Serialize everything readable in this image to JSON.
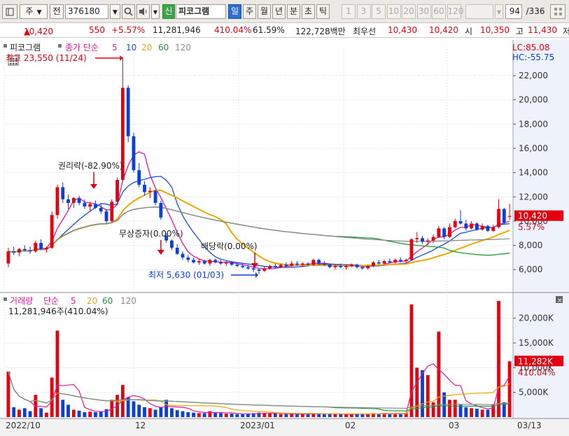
{
  "toolbar": {
    "market_label": "주",
    "chart_label": "전",
    "code": "376180",
    "new_badge": "신",
    "stock_name": "피코그램",
    "periods": [
      "일",
      "주",
      "월",
      "년",
      "분",
      "초",
      "틱"
    ],
    "active_period": "일",
    "intervals": [
      "1",
      "3",
      "5",
      "10",
      "20",
      "30",
      "60",
      "120"
    ],
    "page_count": "94",
    "page_total": "/336"
  },
  "quote": {
    "price": "10,420",
    "change": "550",
    "change_pct": "+5.57%",
    "volume": "11,281,946",
    "volume_ratio": "410.04%",
    "turnover": "61.59%",
    "amount": "122,728백만",
    "ask_label": "최우선",
    "ask": "10,430",
    "bid": "10,420",
    "open_label": "시",
    "open": "10,350",
    "high_label": "고",
    "high": "11,430",
    "low_label": "저"
  },
  "chart_data": [
    {
      "type": "candlestick",
      "title": "피코그램",
      "series_label": "종가 단순",
      "ma_periods": [
        "5",
        "10",
        "20",
        "60",
        "120"
      ],
      "ma_colors": [
        "#e0189c",
        "#1b4ed8",
        "#eba800",
        "#1f9a3a",
        "#8a8a8a"
      ],
      "up_color": "#e3000f",
      "down_color": "#0a3fd8",
      "lc": "LC:85.08",
      "hc": "HC:-55.75",
      "ylim": [
        4800,
        24200
      ],
      "y_ticks": [
        6000,
        8000,
        10000,
        12000,
        14000,
        16000,
        18000,
        20000,
        22000
      ],
      "y_tick_labels": [
        "6,000",
        "8,000",
        "10,000",
        "12,000",
        "14,000",
        "16,000",
        "18,000",
        "20,000",
        "22,000"
      ],
      "x_ticks": [
        "2022/10",
        "12",
        "2023/01",
        "02",
        "03",
        "03/13"
      ],
      "last_price_label": "10,420",
      "last_change_label": "5.57%",
      "last_price": 10420,
      "annotations": {
        "high": "최고 23,550 (11/24)",
        "low": "최저 5,630 (01/03)",
        "rights": "권리락(-82.90%)",
        "bonus": "무상증자(0.00%)",
        "dividend": "배당락(0.00%)"
      },
      "candles": [
        [
          6500,
          7800,
          6200,
          7500
        ],
        [
          7500,
          7900,
          7200,
          7400
        ],
        [
          7400,
          7800,
          7100,
          7700
        ],
        [
          7700,
          8000,
          7500,
          7600
        ],
        [
          7600,
          7900,
          7300,
          7500
        ],
        [
          7500,
          8400,
          7400,
          8200
        ],
        [
          8200,
          8500,
          7600,
          7700
        ],
        [
          7700,
          7900,
          7400,
          7800
        ],
        [
          7800,
          10800,
          7700,
          10500
        ],
        [
          10500,
          13000,
          10200,
          12800
        ],
        [
          12800,
          13200,
          11500,
          11800
        ],
        [
          11800,
          12200,
          11000,
          11500
        ],
        [
          11500,
          12000,
          11100,
          11900
        ],
        [
          11900,
          12100,
          11300,
          11500
        ],
        [
          11500,
          11800,
          11000,
          11200
        ],
        [
          11200,
          11600,
          10800,
          11400
        ],
        [
          11400,
          11700,
          11000,
          11100
        ],
        [
          11100,
          11400,
          10600,
          10800
        ],
        [
          10800,
          11000,
          9800,
          10000
        ],
        [
          10000,
          11800,
          9900,
          11600
        ],
        [
          11600,
          13600,
          11400,
          13400
        ],
        [
          13400,
          23550,
          13300,
          21000
        ],
        [
          21000,
          21200,
          16500,
          17000
        ],
        [
          17000,
          17300,
          14000,
          14200
        ],
        [
          14200,
          14800,
          12800,
          13000
        ],
        [
          13000,
          13300,
          12100,
          12400
        ],
        [
          12400,
          12800,
          11900,
          12500
        ],
        [
          12500,
          12600,
          11300,
          11500
        ],
        [
          11500,
          11700,
          10100,
          10300
        ],
        [
          8800,
          9000,
          8200,
          8400
        ],
        [
          8400,
          8500,
          7600,
          7800
        ],
        [
          7800,
          8100,
          7200,
          7300
        ],
        [
          7300,
          7500,
          6800,
          7000
        ],
        [
          7000,
          7200,
          6600,
          6800
        ],
        [
          6800,
          7000,
          6500,
          6600
        ],
        [
          6600,
          6900,
          6400,
          6700
        ],
        [
          6700,
          6800,
          6400,
          6500
        ],
        [
          6500,
          6900,
          6300,
          6800
        ],
        [
          6800,
          6900,
          6500,
          6600
        ],
        [
          6600,
          6800,
          6400,
          6500
        ],
        [
          6500,
          6700,
          6300,
          6600
        ],
        [
          6600,
          6700,
          6300,
          6400
        ],
        [
          6400,
          6600,
          6200,
          6300
        ],
        [
          6300,
          6500,
          6100,
          6200
        ],
        [
          6200,
          6400,
          6000,
          6100
        ],
        [
          6100,
          6300,
          5800,
          6000
        ],
        [
          6000,
          6100,
          5630,
          5900
        ],
        [
          5900,
          6300,
          5800,
          6100
        ],
        [
          6100,
          6400,
          6000,
          6300
        ],
        [
          6300,
          6500,
          6100,
          6200
        ],
        [
          6200,
          6500,
          6100,
          6400
        ],
        [
          6400,
          6600,
          6200,
          6300
        ],
        [
          6300,
          6700,
          6200,
          6500
        ],
        [
          6500,
          6700,
          6300,
          6400
        ],
        [
          6400,
          6600,
          6200,
          6500
        ],
        [
          6500,
          6600,
          6300,
          6400
        ],
        [
          6400,
          6900,
          6300,
          6800
        ],
        [
          6800,
          6900,
          6400,
          6500
        ],
        [
          6500,
          6700,
          6300,
          6400
        ],
        [
          6400,
          6500,
          6100,
          6200
        ],
        [
          6200,
          6400,
          6000,
          6300
        ],
        [
          6300,
          6500,
          6100,
          6200
        ],
        [
          6200,
          6400,
          6000,
          6300
        ],
        [
          6300,
          6500,
          6200,
          6400
        ],
        [
          6400,
          6500,
          6100,
          6200
        ],
        [
          6200,
          6300,
          6000,
          6100
        ],
        [
          6100,
          6400,
          6000,
          6300
        ],
        [
          6300,
          6700,
          6200,
          6600
        ],
        [
          6600,
          6800,
          6400,
          6500
        ],
        [
          6500,
          6800,
          6400,
          6700
        ],
        [
          6700,
          6900,
          6500,
          6600
        ],
        [
          6600,
          6900,
          6500,
          6800
        ],
        [
          6800,
          7000,
          6600,
          6700
        ],
        [
          6700,
          6900,
          6500,
          6800
        ],
        [
          6800,
          8600,
          6700,
          8500
        ],
        [
          8500,
          9100,
          8200,
          8600
        ],
        [
          8600,
          8800,
          8100,
          8300
        ],
        [
          8300,
          8600,
          8000,
          8400
        ],
        [
          8400,
          8900,
          8200,
          8700
        ],
        [
          8700,
          9600,
          8600,
          9400
        ],
        [
          9400,
          9500,
          8500,
          8700
        ],
        [
          8700,
          9800,
          8600,
          9500
        ],
        [
          9500,
          10200,
          9400,
          10000
        ],
        [
          10000,
          10900,
          9700,
          9800
        ],
        [
          9800,
          10100,
          9200,
          9400
        ],
        [
          9400,
          10000,
          9300,
          9800
        ],
        [
          9800,
          9900,
          9200,
          9300
        ],
        [
          9300,
          9800,
          9200,
          9600
        ],
        [
          9600,
          9700,
          9100,
          9200
        ],
        [
          9200,
          9700,
          9100,
          9500
        ],
        [
          9500,
          11800,
          9400,
          11000
        ],
        [
          11000,
          11100,
          9700,
          9870
        ],
        [
          10350,
          11430,
          10100,
          10420
        ]
      ],
      "bonus_index": 28,
      "dividend_index": 46
    },
    {
      "type": "bar",
      "title": "거래량",
      "series_label": "단순",
      "ma_periods": [
        "5",
        "20",
        "60",
        "120"
      ],
      "volume_readout": "11,281,946주(410.04%)",
      "ylim": [
        0,
        23500
      ],
      "y_ticks": [
        5000,
        10000,
        15000,
        20000
      ],
      "y_tick_labels": [
        "5,000K",
        "10,000K",
        "15,000K",
        "20,000K"
      ],
      "last_volume_label": "11,282K",
      "last_ratio_label": "410.04%",
      "values": [
        9200,
        2000,
        1500,
        1800,
        1200,
        4500,
        1800,
        900,
        8000,
        17500,
        3500,
        2500,
        1500,
        1300,
        1000,
        1100,
        1000,
        1100,
        1600,
        3500,
        4500,
        6500,
        4000,
        3200,
        2500,
        2000,
        1800,
        1500,
        2000,
        3500,
        1800,
        1400,
        1200,
        1000,
        900,
        800,
        800,
        1200,
        900,
        800,
        700,
        700,
        600,
        600,
        700,
        800,
        900,
        800,
        700,
        700,
        600,
        600,
        700,
        600,
        600,
        600,
        800,
        700,
        600,
        600,
        600,
        600,
        600,
        600,
        600,
        600,
        700,
        800,
        700,
        800,
        700,
        700,
        700,
        800,
        22800,
        10000,
        9500,
        8500,
        3000,
        17300,
        5000,
        3500,
        3500,
        2500,
        2000,
        1800,
        1700,
        1500,
        1500,
        2500,
        23500,
        3000,
        11282
      ]
    }
  ]
}
